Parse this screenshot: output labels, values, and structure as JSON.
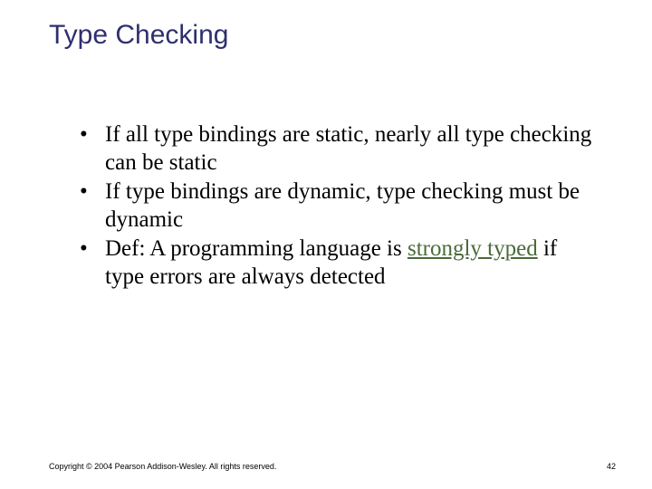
{
  "title": "Type Checking",
  "bullets": [
    {
      "pre": "If all type bindings are static, nearly all type checking can be static",
      "term": "",
      "post": ""
    },
    {
      "pre": "If type bindings are dynamic, type checking must be dynamic",
      "term": "",
      "post": ""
    },
    {
      "pre": "Def: A programming language is ",
      "term": "strongly typed",
      "post": " if type errors are always detected"
    }
  ],
  "footer": "Copyright © 2004 Pearson Addison-Wesley. All rights reserved.",
  "page_number": "42"
}
